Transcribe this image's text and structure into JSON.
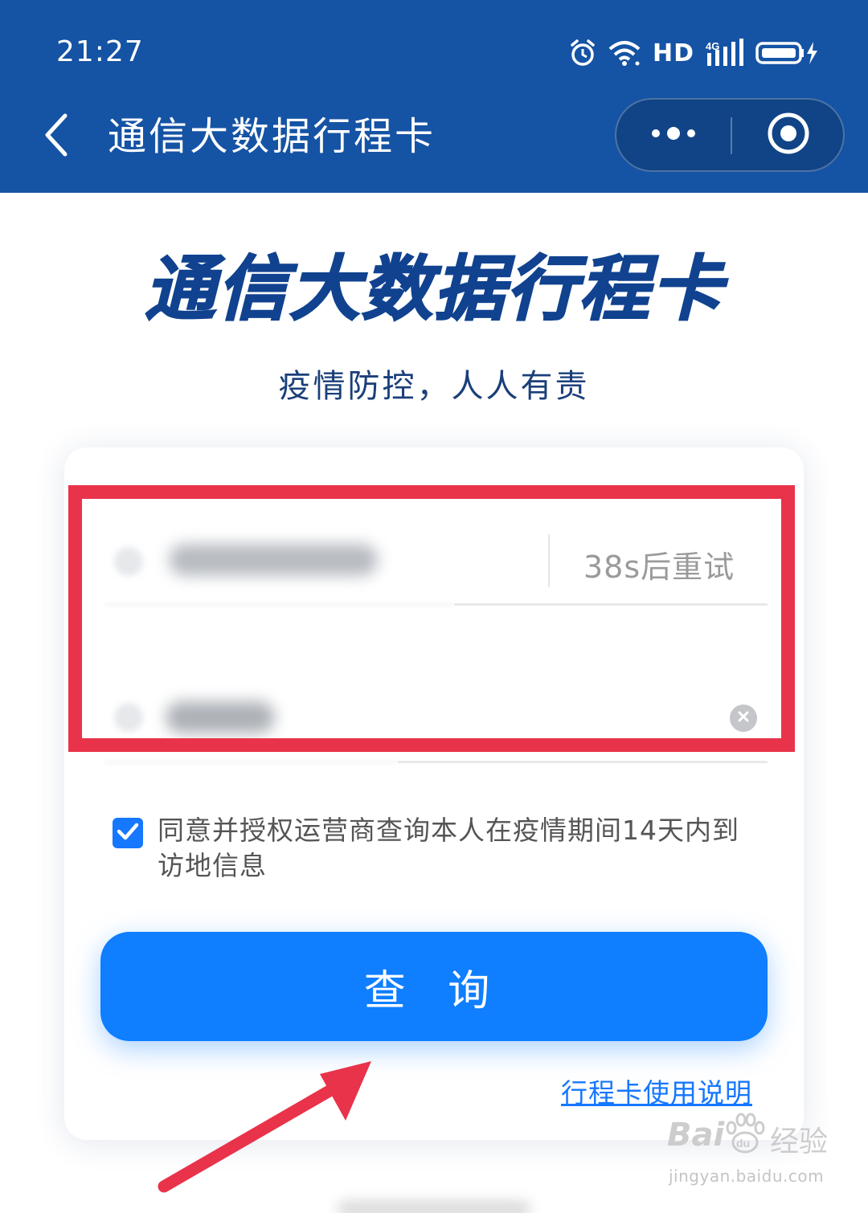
{
  "status_bar": {
    "time": "21:27",
    "hd_label": "HD",
    "network_label": "4G",
    "icons": [
      "alarm-icon",
      "wifi-icon",
      "signal-icon",
      "battery-charging-icon"
    ]
  },
  "nav_bar": {
    "title": "通信大数据行程卡",
    "icons": [
      "back-arrow-icon",
      "more-dots-icon",
      "close-circle-icon"
    ]
  },
  "hero": {
    "title": "通信大数据行程卡",
    "subtitle": "疫情防控，人人有责"
  },
  "form": {
    "resend_label": "38s后重试",
    "agreement_text": "同意并授权运营商查询本人在疫情期间14天内到访地信息",
    "agreement_checked": true,
    "query_button_label": "查 询",
    "guide_link_label": "行程卡使用说明"
  },
  "watermark": {
    "brand": "Bai",
    "brand_suffix": "经验",
    "url": "jingyan.baidu.com"
  },
  "colors": {
    "header_bg": "#1553a4",
    "title_blue": "#10428f",
    "primary": "#0f7eff",
    "highlight_red": "#e8334a"
  }
}
